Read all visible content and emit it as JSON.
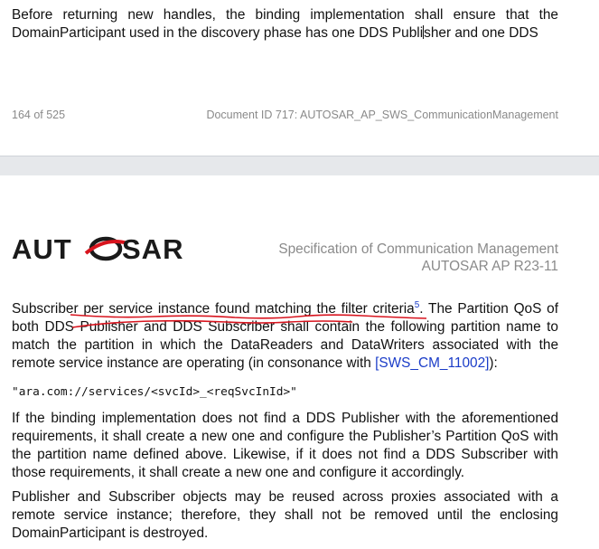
{
  "top_page": {
    "text_before_cursor": "Before returning new handles, the binding implementation shall ensure that the DomainParticipant used in the discovery phase has one DDS Publi",
    "text_after_cursor": "sher and one DDS",
    "footer_page": "164 of 525",
    "footer_doc": "Document ID 717: AUTOSAR_AP_SWS_CommunicationManagement"
  },
  "header": {
    "logo_text": "AUTOSAR",
    "title_line1": "Specification of Communication Management",
    "title_line2": "AUTOSAR AP R23-11"
  },
  "body": {
    "p1_a": "Subscriber per service instance found matching the filter criteria",
    "p1_fn": "5",
    "p1_b": ". The Partition QoS of both DDS Publisher and DDS Subscriber shall contain the following partition name to match the partition in which the DataReaders and DataWriters associated with the remote service instance are operating (in consonance with ",
    "p1_link": "[SWS_CM_11002]",
    "p1_c": "):",
    "code": "\"ara.com://services/<svcId>_<reqSvcInId>\"",
    "p2": "If the binding implementation does not find a DDS Publisher with the aforementioned requirements, it shall create a new one and configure the Publisher’s Partition QoS with the partition name defined above. Likewise, if it does not find a DDS Subscriber with those requirements, it shall create a new one and configure it accordingly.",
    "p3": "Publisher and Subscriber objects may be reused across proxies associated with a remote service instance; therefore, they shall not be removed until the enclosing DomainParticipant is destroyed."
  },
  "colors": {
    "link": "#1a3cc8",
    "annotation": "#d8141e",
    "logo": "#1a1a1a"
  }
}
